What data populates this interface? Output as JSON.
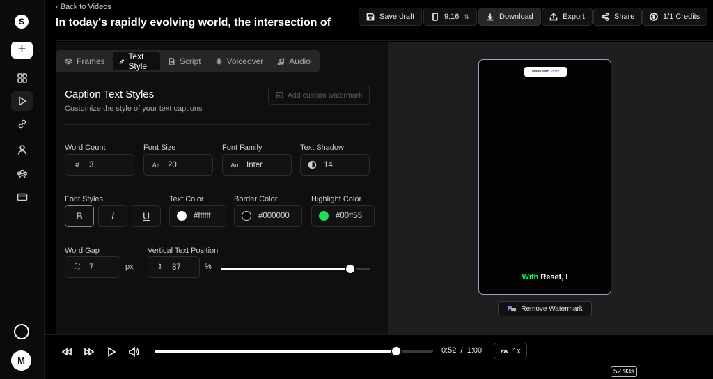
{
  "app": {
    "logo_letter": "S",
    "avatar_letter": "M"
  },
  "header": {
    "back_label": "Back to Videos",
    "title": "In today's rapidly evolving world, the intersection of",
    "save_draft": "Save draft",
    "aspect_ratio": "9:16",
    "download": "Download",
    "export": "Export",
    "share": "Share",
    "credits": "1/1 Credits"
  },
  "tabs": [
    {
      "label": "Frames",
      "icon": "layers-icon"
    },
    {
      "label": "Text Style",
      "icon": "pen-icon"
    },
    {
      "label": "Script",
      "icon": "file-icon"
    },
    {
      "label": "Voiceover",
      "icon": "mic-icon"
    },
    {
      "label": "Audio",
      "icon": "music-icon"
    }
  ],
  "caption_styles": {
    "title": "Caption Text Styles",
    "subtitle": "Customize the style of your text captions",
    "watermark_button": "Add custom watermark",
    "word_count": {
      "label": "Word Count",
      "icon": "#",
      "value": "3"
    },
    "font_size": {
      "label": "Font Size",
      "icon": "A↑",
      "value": "20"
    },
    "font_family": {
      "label": "Font Family",
      "icon": "Aα",
      "value": "Inter"
    },
    "text_shadow": {
      "label": "Text Shadow",
      "value": "14"
    },
    "font_styles": {
      "label": "Font Styles",
      "bold": "B",
      "italic": "I",
      "underline": "U"
    },
    "text_color": {
      "label": "Text Color",
      "value": "#ffffff",
      "swatch": "#ffffff"
    },
    "border_color": {
      "label": "Border Color",
      "value": "#000000",
      "swatch": "#000000"
    },
    "highlight_color": {
      "label": "Highlight Color",
      "value": "#00ff55",
      "swatch": "#22dd55"
    },
    "word_gap": {
      "label": "Word Gap",
      "value": "7",
      "unit": "px"
    },
    "vertical_position": {
      "label": "Vertical Text Position",
      "value": "87",
      "unit": "%",
      "slider_percent": 87
    }
  },
  "preview": {
    "made_with": "Made with",
    "brand": "vidify",
    "caption_highlight": "With",
    "caption_rest": "Reset, I",
    "remove_watermark": "Remove Watermark"
  },
  "player": {
    "current_time": "0:52",
    "separator": "/",
    "total_time": "1:00",
    "speed": "1x",
    "progress_percent": 86.7,
    "timeline_badge": "52.93s"
  }
}
